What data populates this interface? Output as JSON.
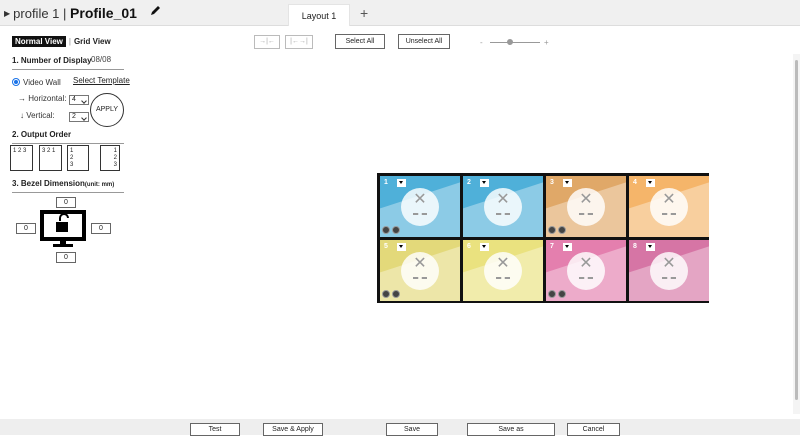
{
  "header": {
    "profile_prefix": "profile 1 |",
    "profile_name": "Profile_01",
    "layout_tab": "Layout 1",
    "add_tab": "+"
  },
  "views": {
    "normal": "Normal View",
    "grid": "Grid View"
  },
  "sections": {
    "displays": "1.  Number of Display",
    "order": "2.  Output Order",
    "bezel": "3.  Bezel Dimension",
    "bezel_unit": "(unit: mm)"
  },
  "display_count": "08/08",
  "video_wall": {
    "label": "Video Wall",
    "template_link": "Select Template",
    "horizontal_label": "Horizontal:",
    "horizontal_value": "4",
    "vertical_label": "Vertical:",
    "vertical_value": "2",
    "apply": "APPLY"
  },
  "output_order": [
    {
      "lines": [
        "1 2 3"
      ]
    },
    {
      "lines": [
        "3 2 1"
      ]
    },
    {
      "lines": [
        "1",
        "2",
        "3"
      ]
    },
    {
      "lines": [
        "1",
        "2",
        "3"
      ]
    }
  ],
  "bezel": {
    "top": "0",
    "left": "0",
    "right": "0",
    "bottom": "0"
  },
  "toolbar": {
    "select_all": "Select All",
    "unselect_all": "Unselect All",
    "zoom_minus": "-",
    "zoom_plus": "+",
    "zoom_level": 0.4
  },
  "tiles": [
    {
      "num": "1",
      "color": "#4fb0d9"
    },
    {
      "num": "2",
      "color": "#4fb0d9"
    },
    {
      "num": "3",
      "color": "#e0a868"
    },
    {
      "num": "4",
      "color": "#f5b56a"
    },
    {
      "num": "5",
      "color": "#e3d97a"
    },
    {
      "num": "6",
      "color": "#eae27f"
    },
    {
      "num": "7",
      "color": "#e47fae"
    },
    {
      "num": "8",
      "color": "#d675a5"
    }
  ],
  "footer": {
    "test": "Test",
    "save_apply": "Save & Apply",
    "save": "Save",
    "save_as": "Save as",
    "cancel": "Cancel"
  }
}
